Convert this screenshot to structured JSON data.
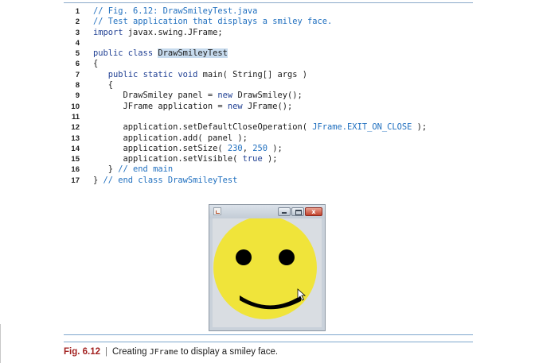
{
  "code_lines": [
    {
      "num": "1",
      "parts": [
        {
          "t": "// Fig. 6.12: DrawSmileyTest.java",
          "c": "cm"
        }
      ]
    },
    {
      "num": "2",
      "parts": [
        {
          "t": "// Test application that displays a smiley face.",
          "c": "cm"
        }
      ]
    },
    {
      "num": "3",
      "parts": [
        {
          "t": "import",
          "c": "kw"
        },
        {
          "t": " javax.swing.JFrame;",
          "c": ""
        }
      ]
    },
    {
      "num": "4",
      "parts": []
    },
    {
      "num": "5",
      "parts": [
        {
          "t": "public class ",
          "c": "kw"
        },
        {
          "t": "DrawSmileyTest",
          "c": "hl"
        }
      ]
    },
    {
      "num": "6",
      "parts": [
        {
          "t": "{",
          "c": ""
        }
      ]
    },
    {
      "num": "7",
      "parts": [
        {
          "t": "   ",
          "c": ""
        },
        {
          "t": "public static void",
          "c": "kw"
        },
        {
          "t": " main( String[] args )",
          "c": ""
        }
      ]
    },
    {
      "num": "8",
      "parts": [
        {
          "t": "   {",
          "c": ""
        }
      ]
    },
    {
      "num": "9",
      "parts": [
        {
          "t": "      DrawSmiley panel = ",
          "c": ""
        },
        {
          "t": "new",
          "c": "kw"
        },
        {
          "t": " DrawSmiley();",
          "c": ""
        }
      ]
    },
    {
      "num": "10",
      "parts": [
        {
          "t": "      JFrame application = ",
          "c": ""
        },
        {
          "t": "new",
          "c": "kw"
        },
        {
          "t": " JFrame();",
          "c": ""
        }
      ]
    },
    {
      "num": "11",
      "parts": []
    },
    {
      "num": "12",
      "parts": [
        {
          "t": "      application.setDefaultCloseOperation( ",
          "c": ""
        },
        {
          "t": "JFrame.EXIT_ON_CLOSE",
          "c": "cst"
        },
        {
          "t": " );",
          "c": ""
        }
      ]
    },
    {
      "num": "13",
      "parts": [
        {
          "t": "      application.add( panel );",
          "c": ""
        }
      ]
    },
    {
      "num": "14",
      "parts": [
        {
          "t": "      application.setSize( ",
          "c": ""
        },
        {
          "t": "230",
          "c": "cst"
        },
        {
          "t": ", ",
          "c": ""
        },
        {
          "t": "250",
          "c": "cst"
        },
        {
          "t": " );",
          "c": ""
        }
      ]
    },
    {
      "num": "15",
      "parts": [
        {
          "t": "      application.setVisible( ",
          "c": ""
        },
        {
          "t": "true",
          "c": "kw"
        },
        {
          "t": " );",
          "c": ""
        }
      ]
    },
    {
      "num": "16",
      "parts": [
        {
          "t": "   } ",
          "c": ""
        },
        {
          "t": "// end main",
          "c": "cm"
        }
      ]
    },
    {
      "num": "17",
      "parts": [
        {
          "t": "} ",
          "c": ""
        },
        {
          "t": "// end class DrawSmileyTest",
          "c": "cm"
        }
      ]
    }
  ],
  "window": {
    "close_glyph": "x",
    "icons": [
      "java-app-icon",
      "minimize-icon",
      "maximize-icon",
      "close-icon"
    ],
    "face_color": "#f0e43a",
    "feature_color": "#000000"
  },
  "caption": {
    "label": "Fig. 6.12",
    "separator": "|",
    "text_before": "Creating ",
    "code": "JFrame",
    "text_after": " to display a smiley face."
  },
  "colors": {
    "comment": "#1f6fbf",
    "keyword": "#1f3f93",
    "figure_label": "#a32322",
    "rule": "#7ea6cd"
  }
}
